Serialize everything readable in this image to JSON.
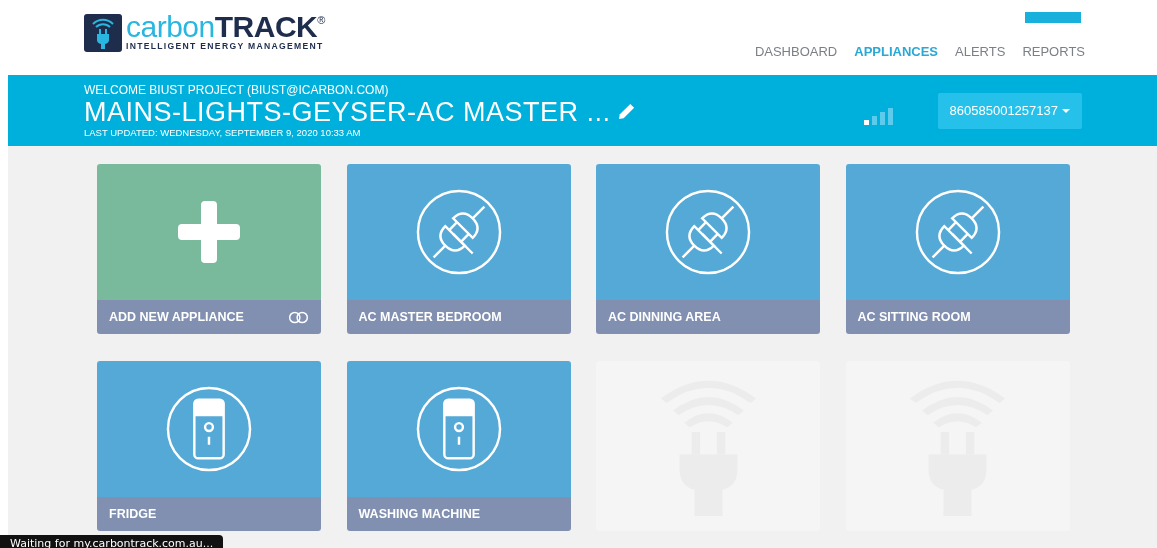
{
  "logo": {
    "brand_light": "carbon",
    "brand_bold": "TRACK",
    "registered": "®",
    "tagline": "INTELLIGENT ENERGY MANAGEMENT"
  },
  "nav": [
    {
      "label": "DASHBOARD",
      "selected": false
    },
    {
      "label": "APPLIANCES",
      "selected": true
    },
    {
      "label": "ALERTS",
      "selected": false
    },
    {
      "label": "REPORTS",
      "selected": false
    }
  ],
  "banner": {
    "welcome": "WELCOME BIUST PROJECT (BIUST@ICARBON.COM)",
    "title": "MAINS-LIGHTS-GEYSER-AC MASTER ...",
    "updated": "LAST UPDATED: WEDNESDAY, SEPTEMBER 9, 2020 10:33 AM",
    "device": "860585001257137"
  },
  "tiles": [
    {
      "kind": "add",
      "label": "ADD NEW APPLIANCE"
    },
    {
      "kind": "plug",
      "label": "AC MASTER BEDROOM"
    },
    {
      "kind": "plug",
      "label": "AC DINNING AREA"
    },
    {
      "kind": "plug",
      "label": "AC SITTING ROOM"
    },
    {
      "kind": "switch",
      "label": "FRIDGE"
    },
    {
      "kind": "switch",
      "label": "WASHING MACHINE"
    },
    {
      "kind": "empty"
    },
    {
      "kind": "empty"
    }
  ],
  "status_bar": "Waiting for my.carbontrack.com.au..."
}
